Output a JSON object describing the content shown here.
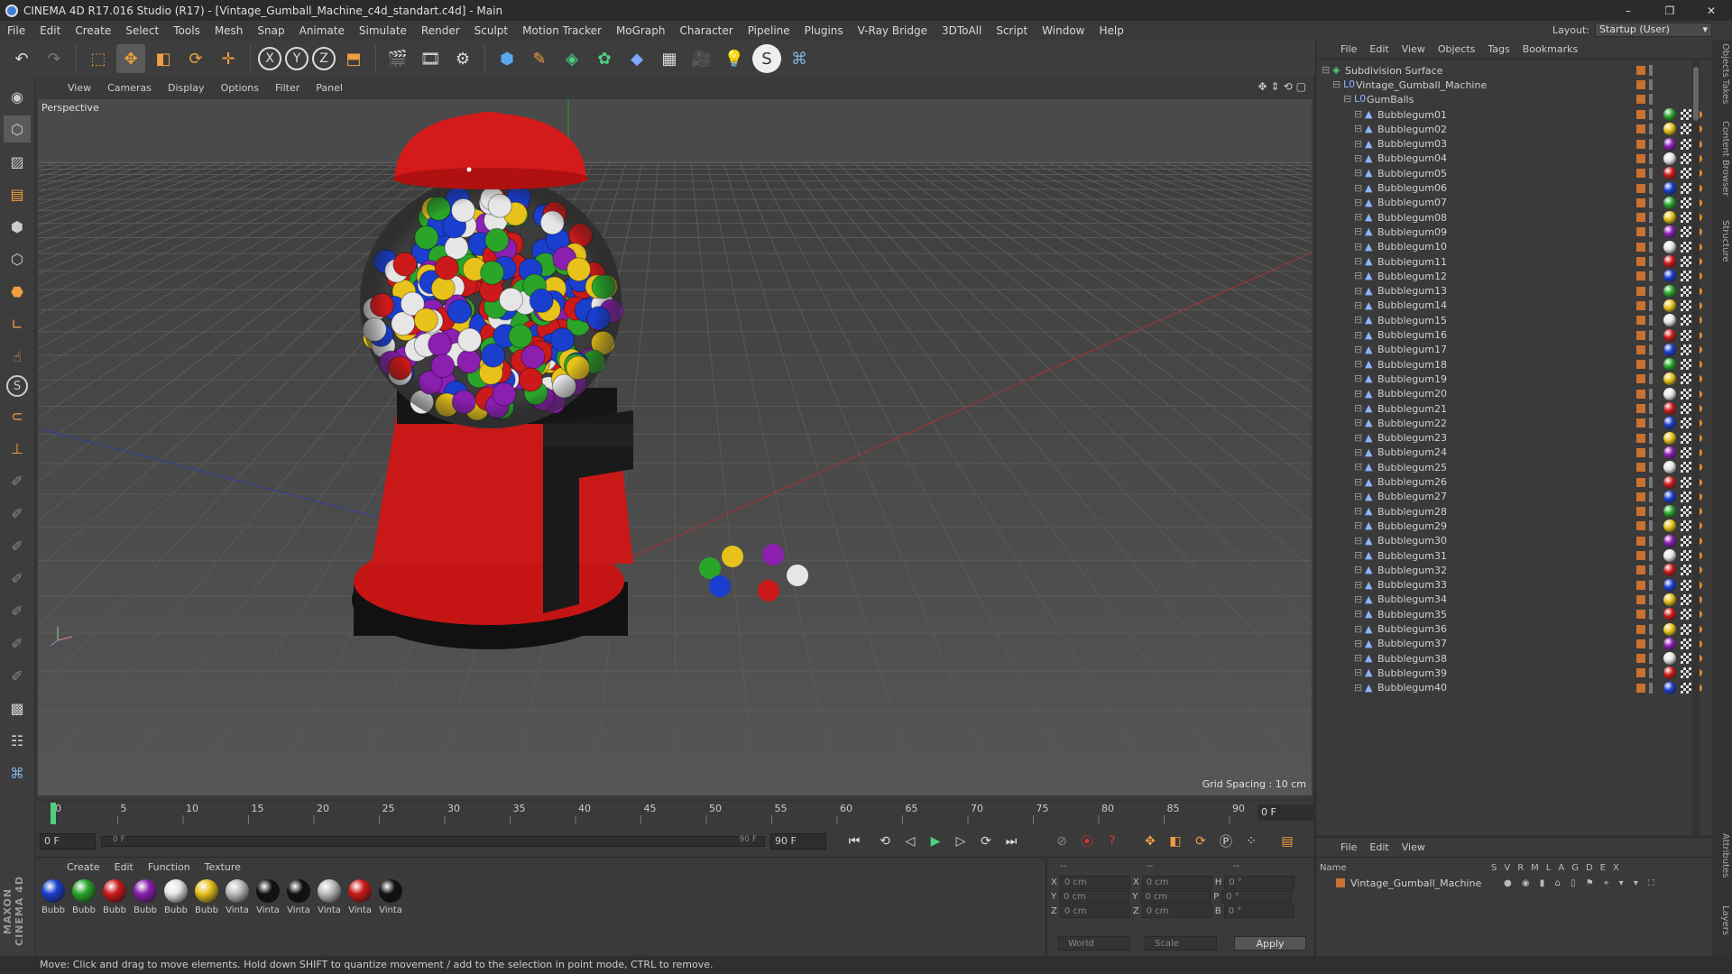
{
  "window": {
    "title": "CINEMA 4D R17.016 Studio (R17) - [Vintage_Gumball_Machine_c4d_standart.c4d] - Main",
    "minimize": "–",
    "maximize": "❐",
    "close": "✕"
  },
  "menu": [
    "File",
    "Edit",
    "Create",
    "Select",
    "Tools",
    "Mesh",
    "Snap",
    "Animate",
    "Simulate",
    "Render",
    "Sculpt",
    "Motion Tracker",
    "MoGraph",
    "Character",
    "Pipeline",
    "Plugins",
    "V-Ray Bridge",
    "3DToAll",
    "Script",
    "Window",
    "Help"
  ],
  "layout": {
    "label": "Layout:",
    "value": "Startup (User)"
  },
  "viewport": {
    "menu": [
      "View",
      "Cameras",
      "Display",
      "Options",
      "Filter",
      "Panel"
    ],
    "camera_label": "Perspective",
    "grid_spacing": "Grid Spacing : 10 cm"
  },
  "timeline": {
    "ticks": [
      "0",
      "5",
      "10",
      "15",
      "20",
      "25",
      "30",
      "35",
      "40",
      "45",
      "50",
      "55",
      "60",
      "65",
      "70",
      "75",
      "80",
      "85",
      "90"
    ],
    "current_frame": "0 F",
    "start_field": "0 F",
    "range_start": "0 F",
    "range_end": "90 F",
    "end_field": "90 F"
  },
  "materials": {
    "menu": [
      "Create",
      "Edit",
      "Function",
      "Texture"
    ],
    "items": [
      {
        "name": "Bubb",
        "color": "#1a3fcf"
      },
      {
        "name": "Bubb",
        "color": "#2aa52a"
      },
      {
        "name": "Bubb",
        "color": "#cc1a1a"
      },
      {
        "name": "Bubb",
        "color": "#8a1fb0"
      },
      {
        "name": "Bubb",
        "color": "#e6e6e6"
      },
      {
        "name": "Bubb",
        "color": "#e6c21a"
      },
      {
        "name": "Vinta",
        "color": "#bcbcbc"
      },
      {
        "name": "Vinta",
        "color": "#111111"
      },
      {
        "name": "Vinta",
        "color": "#111111"
      },
      {
        "name": "Vinta",
        "color": "#bcbcbc"
      },
      {
        "name": "Vinta",
        "color": "#cc1a1a"
      },
      {
        "name": "Vinta",
        "color": "#111111"
      }
    ]
  },
  "coordinates": {
    "header_left": "--",
    "header_mid": "--",
    "header_right": "--",
    "rows": [
      {
        "a": "X",
        "av": "0 cm",
        "b": "X",
        "bv": "0 cm",
        "c": "H",
        "cv": "0 °"
      },
      {
        "a": "Y",
        "av": "0 cm",
        "b": "Y",
        "bv": "0 cm",
        "c": "P",
        "cv": "0 °"
      },
      {
        "a": "Z",
        "av": "0 cm",
        "b": "Z",
        "bv": "0 cm",
        "c": "B",
        "cv": "0 °"
      }
    ],
    "world": "World",
    "scale": "Scale",
    "apply": "Apply"
  },
  "status": "Move: Click and drag to move elements. Hold down SHIFT to quantize movement / add to the selection in point mode, CTRL to remove.",
  "objects": {
    "menu": [
      "File",
      "Edit",
      "View",
      "Objects",
      "Tags",
      "Bookmarks"
    ],
    "root": "Subdivision Surface",
    "machine": "Vintage_Gumball_Machine",
    "group": "GumBalls",
    "items": [
      {
        "name": "Bubblegum01",
        "color": "#2aa52a"
      },
      {
        "name": "Bubblegum02",
        "color": "#e6c21a"
      },
      {
        "name": "Bubblegum03",
        "color": "#8a1fb0"
      },
      {
        "name": "Bubblegum04",
        "color": "#e6e6e6"
      },
      {
        "name": "Bubblegum05",
        "color": "#cc1a1a"
      },
      {
        "name": "Bubblegum06",
        "color": "#1a3fcf"
      },
      {
        "name": "Bubblegum07",
        "color": "#2aa52a"
      },
      {
        "name": "Bubblegum08",
        "color": "#e6c21a"
      },
      {
        "name": "Bubblegum09",
        "color": "#8a1fb0"
      },
      {
        "name": "Bubblegum10",
        "color": "#e6e6e6"
      },
      {
        "name": "Bubblegum11",
        "color": "#cc1a1a"
      },
      {
        "name": "Bubblegum12",
        "color": "#1a3fcf"
      },
      {
        "name": "Bubblegum13",
        "color": "#2aa52a"
      },
      {
        "name": "Bubblegum14",
        "color": "#e6c21a"
      },
      {
        "name": "Bubblegum15",
        "color": "#e6e6e6"
      },
      {
        "name": "Bubblegum16",
        "color": "#cc1a1a"
      },
      {
        "name": "Bubblegum17",
        "color": "#1a3fcf"
      },
      {
        "name": "Bubblegum18",
        "color": "#2aa52a"
      },
      {
        "name": "Bubblegum19",
        "color": "#e6c21a"
      },
      {
        "name": "Bubblegum20",
        "color": "#e6e6e6"
      },
      {
        "name": "Bubblegum21",
        "color": "#cc1a1a"
      },
      {
        "name": "Bubblegum22",
        "color": "#1a3fcf"
      },
      {
        "name": "Bubblegum23",
        "color": "#e6c21a"
      },
      {
        "name": "Bubblegum24",
        "color": "#8a1fb0"
      },
      {
        "name": "Bubblegum25",
        "color": "#e6e6e6"
      },
      {
        "name": "Bubblegum26",
        "color": "#cc1a1a"
      },
      {
        "name": "Bubblegum27",
        "color": "#1a3fcf"
      },
      {
        "name": "Bubblegum28",
        "color": "#2aa52a"
      },
      {
        "name": "Bubblegum29",
        "color": "#e6c21a"
      },
      {
        "name": "Bubblegum30",
        "color": "#8a1fb0"
      },
      {
        "name": "Bubblegum31",
        "color": "#e6e6e6"
      },
      {
        "name": "Bubblegum32",
        "color": "#cc1a1a"
      },
      {
        "name": "Bubblegum33",
        "color": "#1a3fcf"
      },
      {
        "name": "Bubblegum34",
        "color": "#e6c21a"
      },
      {
        "name": "Bubblegum35",
        "color": "#cc1a1a"
      },
      {
        "name": "Bubblegum36",
        "color": "#e6c21a"
      },
      {
        "name": "Bubblegum37",
        "color": "#8a1fb0"
      },
      {
        "name": "Bubblegum38",
        "color": "#e6e6e6"
      },
      {
        "name": "Bubblegum39",
        "color": "#cc1a1a"
      },
      {
        "name": "Bubblegum40",
        "color": "#1a3fcf"
      }
    ]
  },
  "layers": {
    "menu": [
      "File",
      "Edit",
      "View"
    ],
    "header": "Name",
    "flags": [
      "S",
      "V",
      "R",
      "M",
      "L",
      "A",
      "G",
      "D",
      "E",
      "X"
    ],
    "row": "Vintage_Gumball_Machine"
  },
  "right_tabs": [
    "Objects",
    "Takes",
    "Content Browser",
    "Structure",
    "Attributes",
    "Layers"
  ],
  "brand": "MAXON CINEMA 4D"
}
